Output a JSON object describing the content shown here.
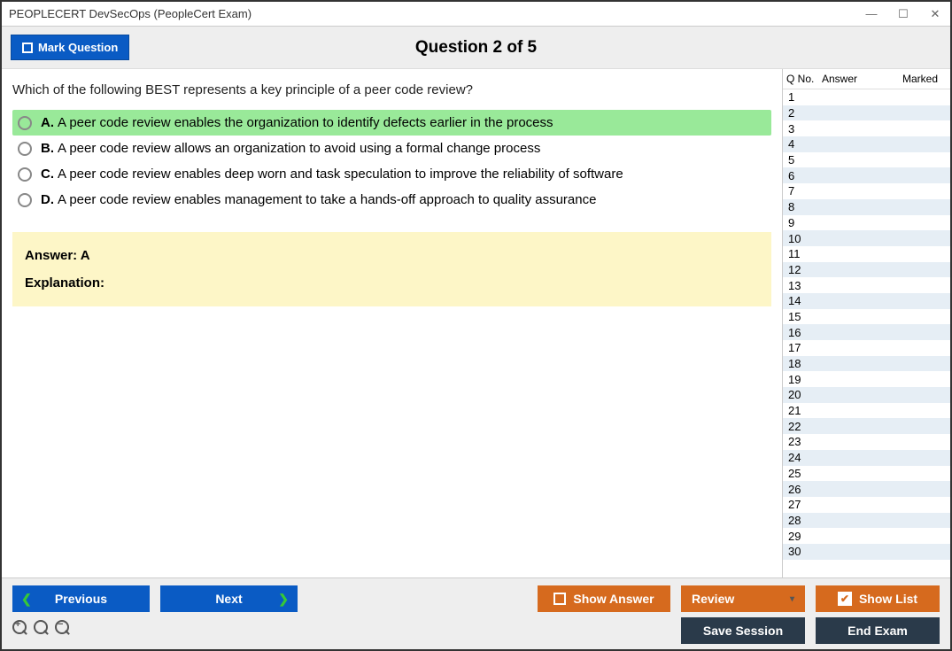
{
  "window": {
    "title": "PEOPLECERT DevSecOps (PeopleCert Exam)"
  },
  "header": {
    "mark_label": "Mark Question",
    "question_title": "Question 2 of 5"
  },
  "question": {
    "text": "Which of the following BEST represents a key principle of a peer code review?",
    "options": [
      {
        "letter": "A.",
        "text": "A peer code review enables the organization to identify defects earlier in the process",
        "selected": true
      },
      {
        "letter": "B.",
        "text": "A peer code review allows an organization to avoid using a formal change process",
        "selected": false
      },
      {
        "letter": "C.",
        "text": "A peer code review enables deep worn and task speculation to improve the reliability of software",
        "selected": false
      },
      {
        "letter": "D.",
        "text": "A peer code review enables management to take a hands-off approach to quality assurance",
        "selected": false
      }
    ],
    "answer_label": "Answer: A",
    "explanation_label": "Explanation:"
  },
  "sidebar": {
    "columns": {
      "qno": "Q No.",
      "answer": "Answer",
      "marked": "Marked"
    },
    "row_count": 30
  },
  "footer": {
    "previous": "Previous",
    "next": "Next",
    "show_answer": "Show Answer",
    "review": "Review",
    "show_list": "Show List",
    "save_session": "Save Session",
    "end_exam": "End Exam"
  }
}
